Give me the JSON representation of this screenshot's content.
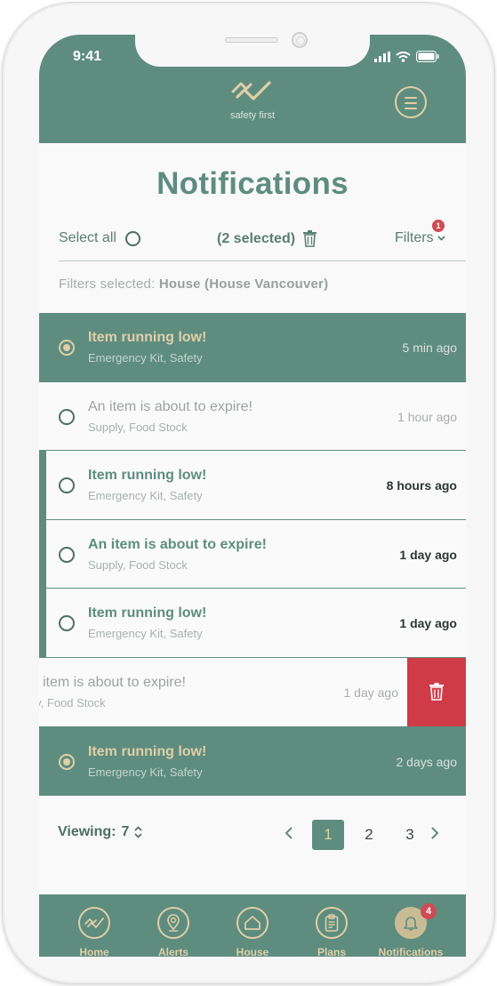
{
  "status_bar": {
    "time": "9:41"
  },
  "header": {
    "logo_text": "safety first"
  },
  "page": {
    "title": "Notifications"
  },
  "toolbar": {
    "select_all_label": "Select all",
    "selected_count": "(2 selected)",
    "filters_label": "Filters",
    "filters_badge": "1"
  },
  "filters_selected": {
    "label": "Filters selected:",
    "value": "House (House Vancouver)"
  },
  "notifications": [
    {
      "title": "Item running low!",
      "subtitle": "Emergency Kit, Safety",
      "time": "5 min ago",
      "selected": true
    },
    {
      "title": "An item is about to expire!",
      "subtitle": "Supply, Food Stock",
      "time": "1 hour ago",
      "read": true
    },
    {
      "title": "Item running low!",
      "subtitle": "Emergency Kit, Safety",
      "time": "8 hours ago",
      "unread": true
    },
    {
      "title": "An item is about to expire!",
      "subtitle": "Supply, Food Stock",
      "time": "1 day ago",
      "unread": true
    },
    {
      "title": "Item running low!",
      "subtitle": "Emergency Kit, Safety",
      "time": "1 day ago",
      "unread": true
    },
    {
      "title": "item is about to expire!",
      "subtitle": "ply, Food Stock",
      "time": "1 day ago",
      "swiped": true,
      "read": true
    },
    {
      "title": "Item running low!",
      "subtitle": "Emergency Kit, Safety",
      "time": "2 days ago",
      "selected": true
    }
  ],
  "pagination": {
    "viewing_label": "Viewing:",
    "viewing_value": "7",
    "pages": [
      "1",
      "2",
      "3"
    ],
    "current_page": "1"
  },
  "tabbar": {
    "items": [
      {
        "label": "Home",
        "icon": "activity-icon"
      },
      {
        "label": "Alerts",
        "icon": "location-pin-icon"
      },
      {
        "label": "House",
        "icon": "house-icon"
      },
      {
        "label": "Plans",
        "icon": "clipboard-icon"
      },
      {
        "label": "Notifications",
        "icon": "bell-icon",
        "active": true
      }
    ],
    "notifications_badge": "4"
  },
  "colors": {
    "primary": "#5e8d7f",
    "accent": "#e0cfa8",
    "danger": "#d03b48",
    "badge": "#d04b54"
  }
}
